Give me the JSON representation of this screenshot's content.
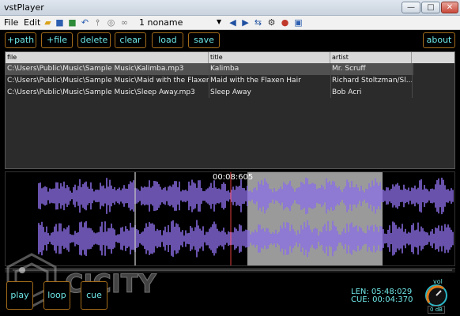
{
  "window": {
    "title": "vstPlayer",
    "min_glyph": "—",
    "max_glyph": "□",
    "close_glyph": "✕"
  },
  "menu": {
    "file": "File",
    "edit": "Edit"
  },
  "toolbar": {
    "preset_label": "1 noname",
    "icons": [
      "open-folder-icon",
      "save-icon",
      "save-as-icon",
      "undo-icon",
      "fork-icon",
      "cd-icon",
      "link-icon",
      "prev-icon",
      "next-icon",
      "swap-icon",
      "settings-icon",
      "stop-icon",
      "export-icon"
    ]
  },
  "actions": {
    "add_path": "+path",
    "add_file": "+file",
    "delete": "delete",
    "clear": "clear",
    "load": "load",
    "save": "save",
    "about": "about"
  },
  "playlist": {
    "headers": [
      "file",
      "title",
      "artist"
    ],
    "rows": [
      {
        "file": "C:\\Users\\Public\\Music\\Sample Music\\Kalimba.mp3",
        "title": "Kalimba",
        "artist": "Mr. Scruff",
        "selected": true
      },
      {
        "file": "C:\\Users\\Public\\Music\\Sample Music\\Maid with the Flaxen...",
        "title": "Maid with the Flaxen Hair",
        "artist": "Richard Stoltzman/Sl...",
        "selected": false
      },
      {
        "file": "C:\\Users\\Public\\Music\\Sample Music\\Sleep Away.mp3",
        "title": "Sleep Away",
        "artist": "Bob Acri",
        "selected": false
      }
    ]
  },
  "waveform": {
    "position_time": "00:08:605",
    "wave_color": "#8a6ee6",
    "selection_color": "#9a9a9a",
    "playhead_color": "#e23b3b"
  },
  "controls": {
    "play": "play",
    "loop": "loop",
    "cue": "cue",
    "len": "LEN: 05:48:029",
    "cue_time": "CUE: 00:04:370",
    "vol_label": "vol",
    "vol_value": "0 dB"
  },
  "watermark": {
    "text": "CJCITY"
  }
}
